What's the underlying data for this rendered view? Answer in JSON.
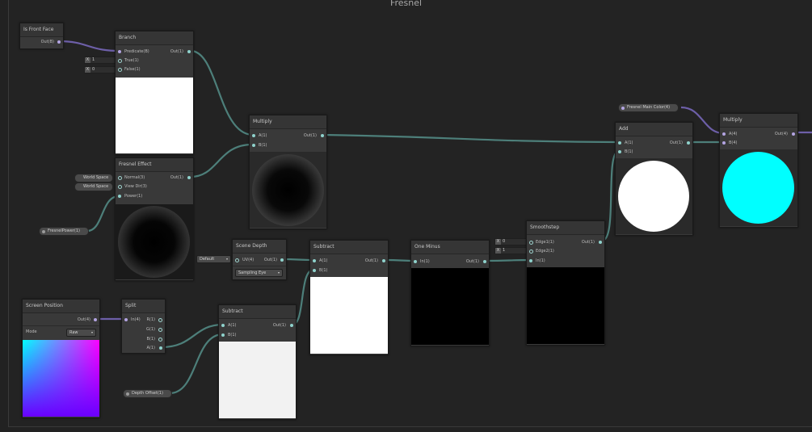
{
  "graph": {
    "title": "Fresnel"
  },
  "colors": {
    "wire": "#4d7f7a",
    "wire_purple": "#6d5fa8",
    "port_teal": "#8fd2cc",
    "cyan": "#00ffff"
  },
  "nodes": {
    "is_front_face": {
      "title": "Is Front Face",
      "out": "Out(B)"
    },
    "branch": {
      "title": "Branch",
      "in1": "Predicate(B)",
      "in2": "True(1)",
      "in3": "False(1)",
      "out": "Out(1)",
      "true_x": "X",
      "true_val": "1",
      "false_x": "X",
      "false_val": "0"
    },
    "fresnel_effect": {
      "title": "Fresnel Effect",
      "in1": "Normal(3)",
      "in2": "View Dir(3)",
      "in3": "Power(1)",
      "out": "Out(1)",
      "normal_space": "World Space",
      "viewdir_space": "World Space"
    },
    "fresnel_power": {
      "label": "FresnelPower(1)"
    },
    "multiply1": {
      "title": "Multiply",
      "in1": "A(1)",
      "in2": "B(1)",
      "out": "Out(1)"
    },
    "scene_depth": {
      "title": "Scene Depth",
      "in1": "UV(4)",
      "out": "Out(1)",
      "uv_default": "Default",
      "mode": "Eye",
      "sampling": "Sampling"
    },
    "screen_position": {
      "title": "Screen Position",
      "out": "Out(4)",
      "mode_label": "Mode",
      "mode_value": "Raw"
    },
    "split": {
      "title": "Split",
      "in1": "In(4)",
      "outs": [
        "R(1)",
        "G(1)",
        "B(1)",
        "A(1)"
      ]
    },
    "subtract_low": {
      "title": "Subtract",
      "in1": "A(1)",
      "in2": "B(1)",
      "out": "Out(1)"
    },
    "depth_offset": {
      "label": "Depth Offset(1)"
    },
    "subtract_mid": {
      "title": "Subtract",
      "in1": "A(1)",
      "in2": "B(1)",
      "out": "Out(1)"
    },
    "one_minus": {
      "title": "One Minus",
      "in1": "In(1)",
      "out": "Out(1)"
    },
    "smoothstep": {
      "title": "Smoothstep",
      "in1": "Edge1(1)",
      "in2": "Edge2(1)",
      "in3": "In(1)",
      "out": "Out(1)",
      "e1_x": "X",
      "e1_val": "0",
      "e2_x": "X",
      "e2_val": "1"
    },
    "fresnel_main_color": {
      "label": "Fresnel Main Color(4)"
    },
    "add": {
      "title": "Add",
      "in1": "A(1)",
      "in2": "B(1)",
      "out": "Out(1)"
    },
    "multiply2": {
      "title": "Multiply",
      "in1": "A(4)",
      "in2": "B(4)",
      "out": "Out(4)"
    }
  }
}
